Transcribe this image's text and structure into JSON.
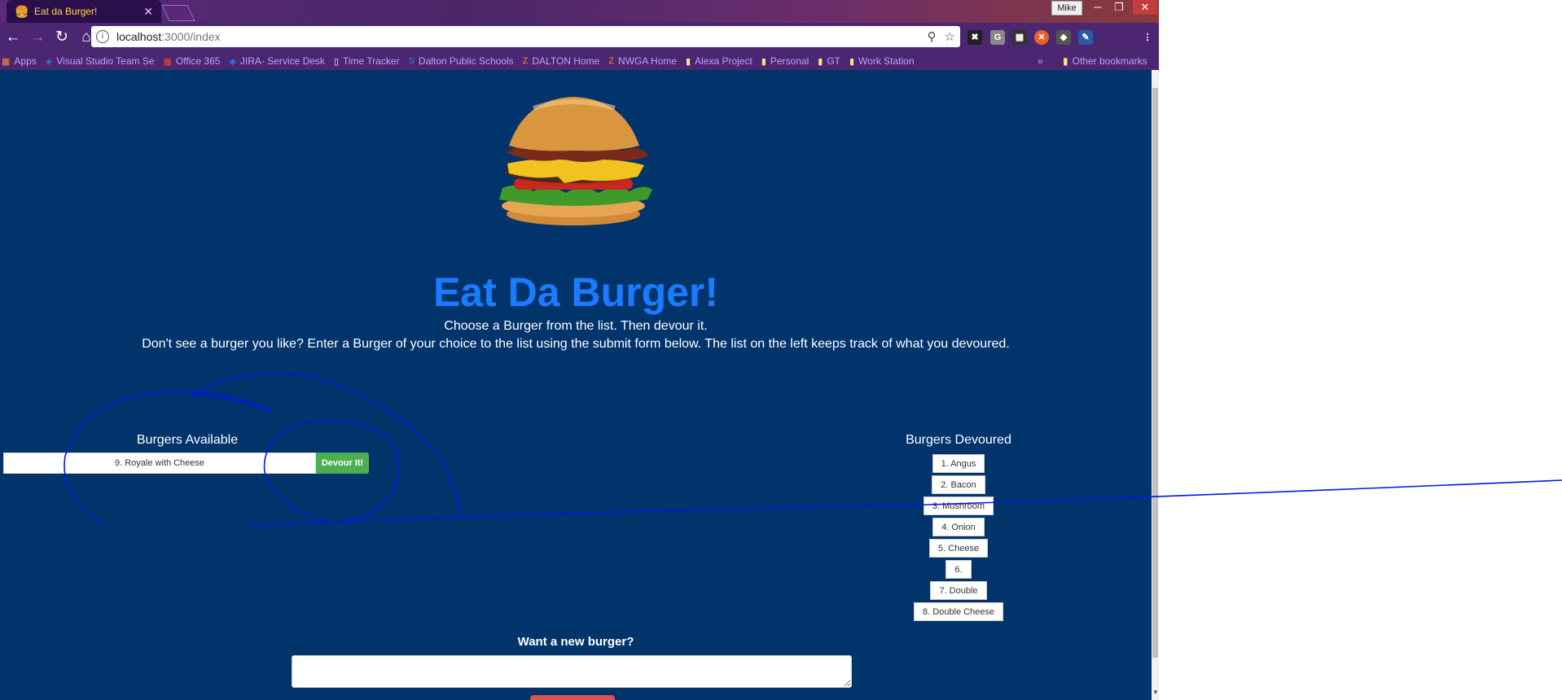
{
  "window": {
    "tab_title": "Eat da Burger!",
    "user": "Mike"
  },
  "toolbar": {
    "url_host": "localhost",
    "url_path": ":3000/index"
  },
  "bookmarks": {
    "items": [
      {
        "label": "Apps",
        "icon": "apps-grid-icon"
      },
      {
        "label": "Visual Studio Team Se",
        "icon": "vsts-icon"
      },
      {
        "label": "Office 365",
        "icon": "office-icon"
      },
      {
        "label": "JIRA- Service Desk",
        "icon": "jira-icon"
      },
      {
        "label": "Time Tracker",
        "icon": "page-icon"
      },
      {
        "label": "Dalton Public Schools",
        "icon": "sharepoint-icon"
      },
      {
        "label": "DALTON Home",
        "icon": "z-icon"
      },
      {
        "label": "NWGA Home",
        "icon": "z-icon"
      },
      {
        "label": "Alexa Project",
        "icon": "folder-icon"
      },
      {
        "label": "Personal",
        "icon": "folder-icon"
      },
      {
        "label": "GT",
        "icon": "folder-icon"
      },
      {
        "label": "Work Station",
        "icon": "folder-icon"
      }
    ],
    "more": "»",
    "other": "Other bookmarks"
  },
  "page": {
    "title": "Eat Da Burger!",
    "subtitle_1": "Choose a Burger from the list. Then devour it.",
    "subtitle_2": "Don't see a burger you like? Enter a Burger of your choice to the list using the submit form below. The list on the left keeps track of what you devoured.",
    "available_heading": "Burgers Available",
    "available_items": [
      {
        "name": "9. Royale with Cheese",
        "button": "Devour It!"
      }
    ],
    "devoured_heading": "Burgers Devoured",
    "devoured_items": [
      "1. Angus",
      "2. Bacon",
      "3. Mushroom",
      "4. Onion",
      "5. Cheese",
      "6.",
      "7. Double",
      "8. Double Cheese"
    ],
    "new_heading": "Want a new burger?",
    "new_input_value": ""
  },
  "colors": {
    "page_background": "#00346b",
    "title": "#1a7bff",
    "devour_button": "#4caf50",
    "annotation_ink": "#0018e0"
  }
}
